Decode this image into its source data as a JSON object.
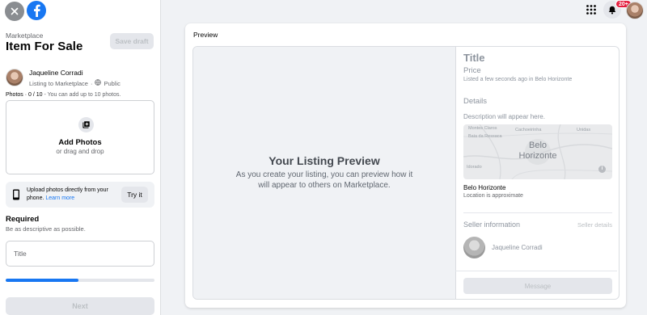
{
  "top_left": {
    "close_icon": "close-icon",
    "logo_icon": "facebook-logo-icon"
  },
  "left_panel": {
    "section_label": "Marketplace",
    "title": "Item For Sale",
    "save_draft_label": "Save draft",
    "user": {
      "name": "Jaqueline Corradi",
      "listing_to": "Listing to Marketplace",
      "separator": "·",
      "privacy": "Public"
    },
    "photos": {
      "label": "Photos · 0 / 10",
      "hint": " - You can add up to 10 photos."
    },
    "add_photos": {
      "label": "Add Photos",
      "sublabel": "or drag and drop"
    },
    "upload": {
      "text": "Upload photos directly from your phone.",
      "link": "Learn more",
      "button": "Try it"
    },
    "required": {
      "heading": "Required",
      "subtext": "Be as descriptive as possible."
    },
    "title_field": {
      "placeholder": "Title",
      "value": ""
    },
    "progress_percent": 49,
    "next_label": "Next"
  },
  "top_right": {
    "menu_icon": "grid-menu-icon",
    "bell_icon": "bell-icon",
    "notification_count": "20+"
  },
  "preview": {
    "header": "Preview",
    "placeholder_title": "Your Listing Preview",
    "placeholder_text": "As you create your listing, you can preview how it will appear to others on Marketplace.",
    "details": {
      "title": "Title",
      "price": "Price",
      "listed": "Listed a few seconds ago in Belo Horizonte",
      "details_heading": "Details",
      "description": "Description will appear here.",
      "map": {
        "city_line1": "Belo",
        "city_line2": "Horizonte",
        "labels": [
          "Cachoeirinha",
          "Unidas",
          "Baia da Ressaca",
          "Idorado",
          "Montes Claros"
        ]
      },
      "location_name": "Belo Horizonte",
      "location_note": "Location is approximate",
      "seller_heading": "Seller information",
      "seller_details_link": "Seller details",
      "seller_name": "Jaqueline Corradi",
      "message_label": "Message"
    }
  },
  "colors": {
    "accent": "#1877f2",
    "badge": "#e41e3f",
    "background": "#f0f2f5"
  }
}
